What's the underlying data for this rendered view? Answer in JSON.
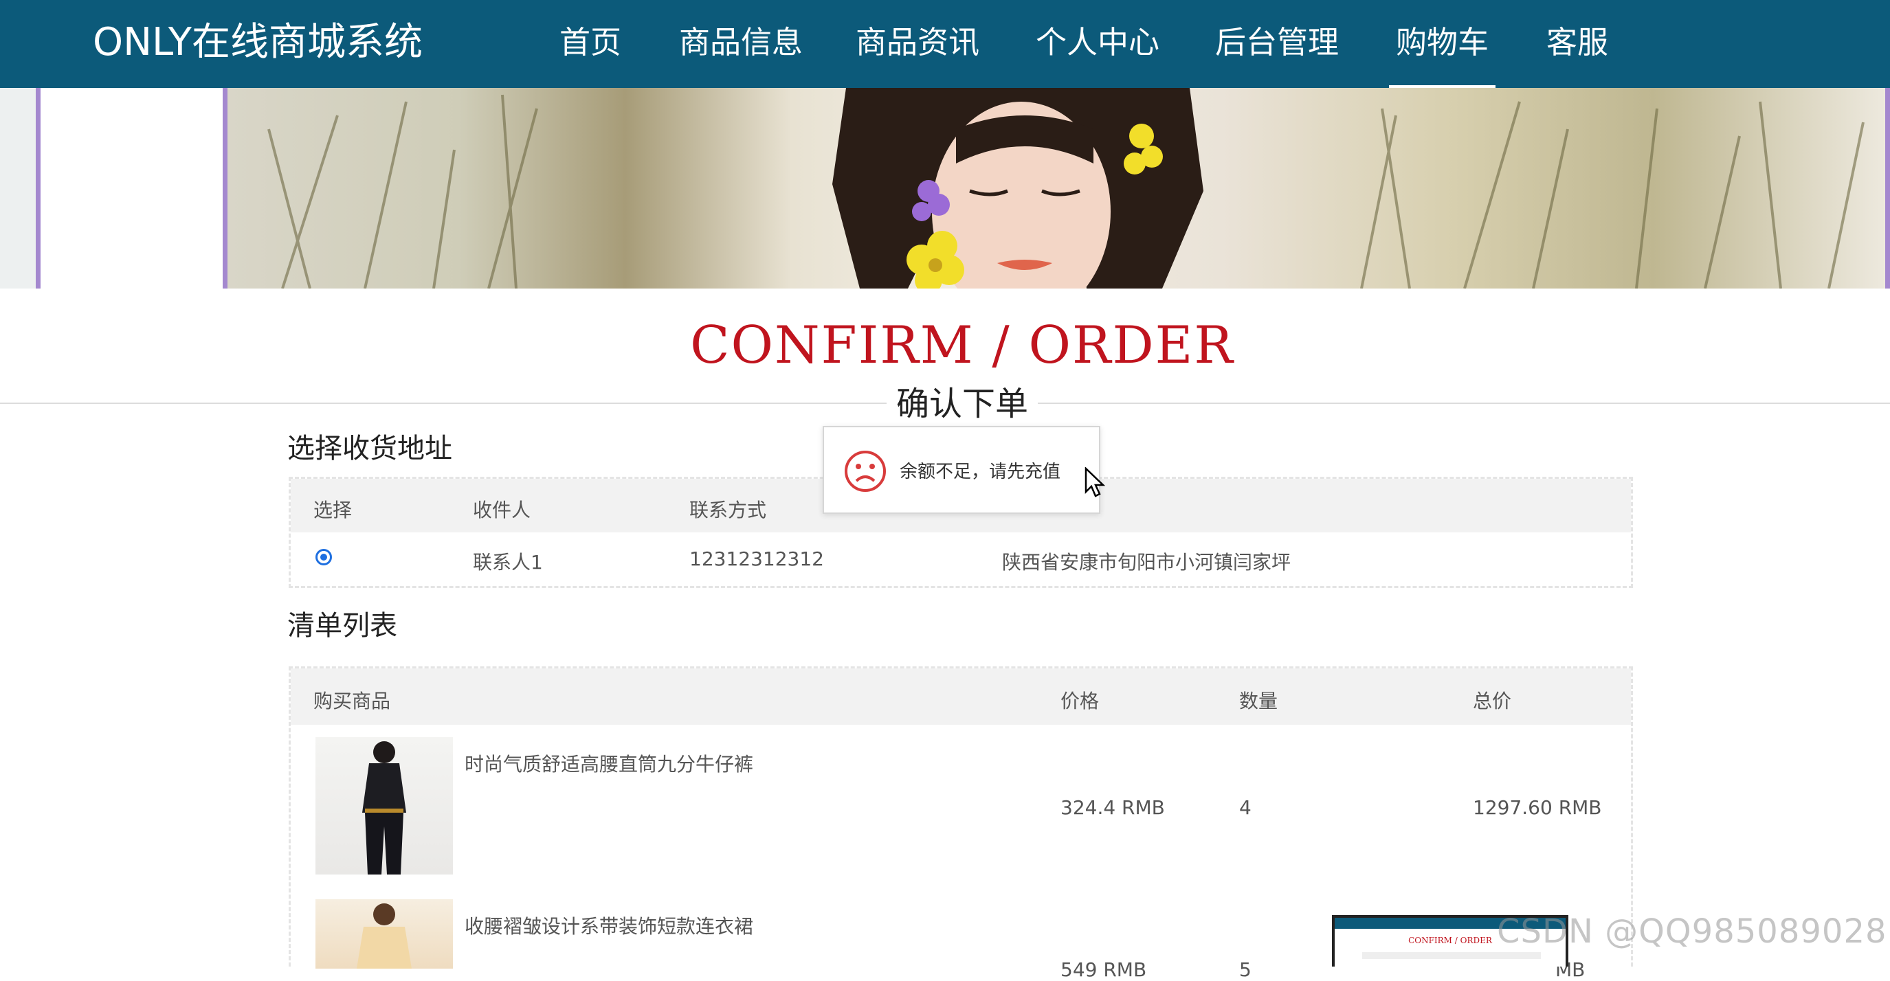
{
  "header": {
    "brand": "ONLY在线商城系统",
    "nav": [
      {
        "label": "首页"
      },
      {
        "label": "商品信息"
      },
      {
        "label": "商品资讯"
      },
      {
        "label": "个人中心"
      },
      {
        "label": "后台管理"
      },
      {
        "label": "购物车",
        "active": true
      },
      {
        "label": "客服"
      }
    ]
  },
  "page": {
    "title": "CONFIRM / ORDER",
    "subtitle": "确认下单"
  },
  "address_section": {
    "title": "选择收货地址",
    "columns": [
      "选择",
      "收件人",
      "联系方式"
    ],
    "rows": [
      {
        "selected": true,
        "recipient": "联系人1",
        "phone": "12312312312",
        "address": "陕西省安康市旬阳市小河镇闫家坪"
      }
    ]
  },
  "list_section": {
    "title": "清单列表",
    "columns": [
      "购买商品",
      "价格",
      "数量",
      "总价"
    ],
    "items": [
      {
        "name": "时尚气质舒适高腰直筒九分牛仔裤",
        "price": "324.4 RMB",
        "qty": "4",
        "total": "1297.60 RMB"
      },
      {
        "name": "收腰褶皱设计系带装饰短款连衣裙",
        "price": "549 RMB",
        "qty": "5",
        "total": "MB"
      }
    ]
  },
  "popup": {
    "message": "余额不足，请先充值",
    "icon": "sad-face-icon"
  },
  "overlay": {
    "mini_title": "CONFIRM / ORDER",
    "watermark": "CSDN @QQ985089028"
  },
  "colors": {
    "nav_bg": "#0c5a7a",
    "title_red": "#c0141e",
    "popup_icon": "#d83b3b",
    "radio_blue": "#1e6fe0"
  }
}
